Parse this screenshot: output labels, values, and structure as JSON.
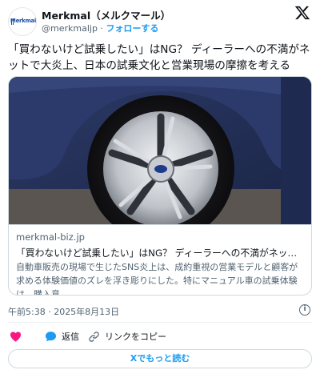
{
  "account": {
    "name": "Merkmal（メルクマール）",
    "handle": "@merkmaljp",
    "separator": " · ",
    "follow_label": "フォローする",
    "avatar_logo_text": "Merkmal",
    "avatar_icon": "merkmal-logo-icon"
  },
  "x_logo": {
    "icon": "x-logo-icon",
    "glyph": "X"
  },
  "tweet": {
    "text": "「買わないけど試乗したい」はNG？ ディーラーへの不満がネットで大炎上、日本の試乗文化と営業現場の摩擦を考える"
  },
  "card": {
    "image_icon": "car-wheel-photo",
    "domain": "merkmal-biz.jp",
    "title": "「買わないけど試乗したい」はNG？ ディーラーへの不満がネットで大炎上…",
    "description": "自動車販売の現場で生じたSNS炎上は、成約重視の営業モデルと顧客が求める体験価値のズレを浮き彫りにした。特にマニュアル車の試乗体験は、購入意…"
  },
  "meta": {
    "timestamp": "午前5:38 · 2025年8月13日",
    "info_icon": "info-icon"
  },
  "actions": {
    "like_icon": "heart-icon",
    "reply_icon": "reply-icon",
    "reply_label": "返信",
    "copy_icon": "link-icon",
    "copy_label": "リンクをコピー"
  },
  "read_more": {
    "label": "Xでもっと読む"
  },
  "colors": {
    "accent": "#1d9bf0",
    "like": "#f91880",
    "text": "#0f1419",
    "muted": "#536471"
  }
}
